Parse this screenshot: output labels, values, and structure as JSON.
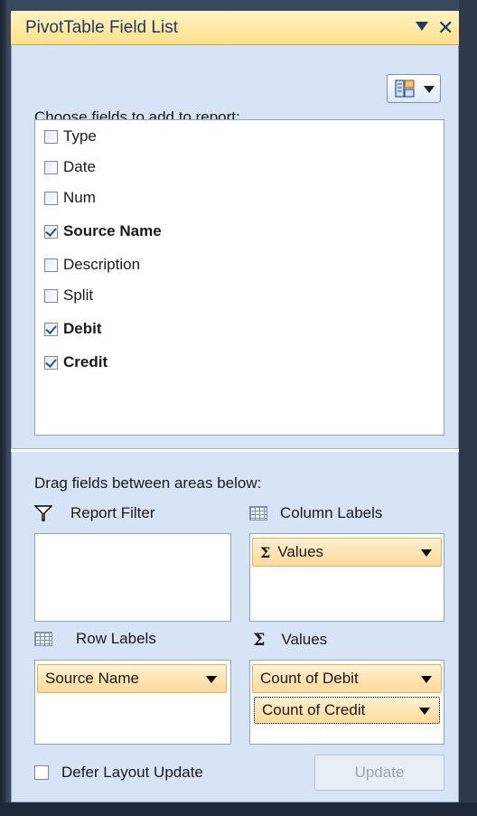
{
  "panel": {
    "title": "PivotTable Field List",
    "choose_label": "Choose fields to add to report:",
    "drag_label": "Drag fields between areas below:"
  },
  "fields": [
    {
      "label": "Type",
      "checked": false
    },
    {
      "label": "Date",
      "checked": false
    },
    {
      "label": "Num",
      "checked": false
    },
    {
      "label": "Source Name",
      "checked": true
    },
    {
      "label": "Description",
      "checked": false
    },
    {
      "label": "Split",
      "checked": false
    },
    {
      "label": "Debit",
      "checked": true
    },
    {
      "label": "Credit",
      "checked": true
    }
  ],
  "areas": {
    "report_filter": {
      "label": "Report Filter",
      "items": []
    },
    "column_labels": {
      "label": "Column Labels",
      "items": [
        "Values"
      ]
    },
    "row_labels": {
      "label": "Row Labels",
      "items": [
        "Source Name"
      ]
    },
    "values": {
      "label": "Values",
      "items": [
        "Count of Debit",
        "Count of Credit"
      ]
    }
  },
  "footer": {
    "defer_label": "Defer Layout Update",
    "defer_checked": false,
    "update_label": "Update"
  },
  "icons": {
    "title_dropdown": "dropdown-arrow-icon",
    "title_close": "close-icon",
    "layout_button": "field-list-layout-icon",
    "report_filter": "filter-icon",
    "column_labels": "grid-icon",
    "row_labels": "grid-icon",
    "values": "sigma-icon"
  },
  "symbols": {
    "close": "✕",
    "sigma": "Σ"
  },
  "colors": {
    "title_bg": "#ffe08a",
    "panel_bg": "#d6e4f5",
    "chip_bg": "#ffd99a"
  }
}
